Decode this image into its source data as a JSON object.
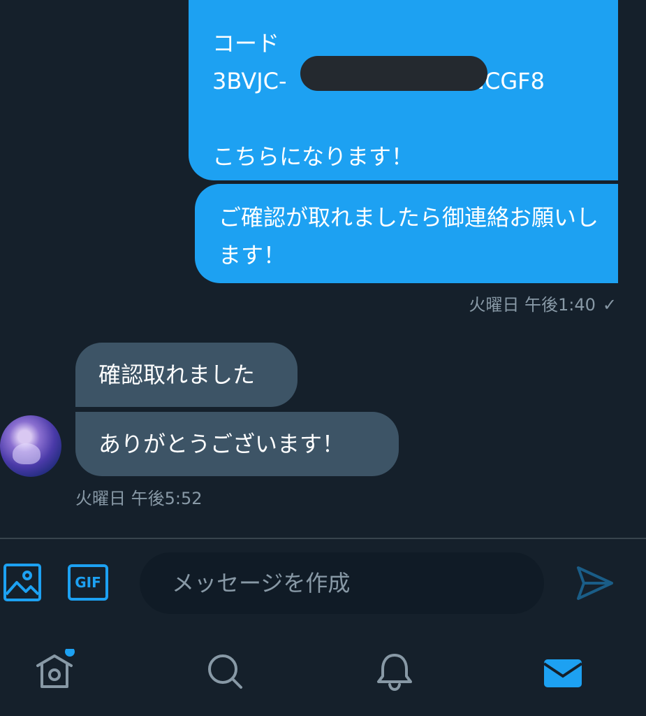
{
  "conversation": {
    "outgoing": {
      "code_label": "コード",
      "code_prefix": "3BVJC-",
      "code_suffix": "-NCGF8",
      "code_note": "こちらになります！",
      "confirm_message": "ご確認が取れましたら御連絡お願いします！",
      "timestamp": "火曜日 午後1:40",
      "read_mark": "✓"
    },
    "incoming": {
      "message_1": "確認取れました",
      "message_2": "ありがとうございます！",
      "timestamp": "火曜日 午後5:52"
    }
  },
  "composer": {
    "placeholder": "メッセージを作成",
    "gif_label": "GIF",
    "image_icon": "image-icon",
    "send_icon": "send-icon"
  },
  "tab_bar": {
    "items": [
      {
        "icon": "home-icon",
        "has_badge": true
      },
      {
        "icon": "search-icon"
      },
      {
        "icon": "bell-icon"
      },
      {
        "icon": "mail-icon",
        "active": true
      }
    ]
  },
  "colors": {
    "background": "#15202b",
    "accent": "#1da1f2",
    "incoming_bubble": "#3d5466",
    "muted_text": "#8899a6",
    "input_background": "#101b26"
  }
}
